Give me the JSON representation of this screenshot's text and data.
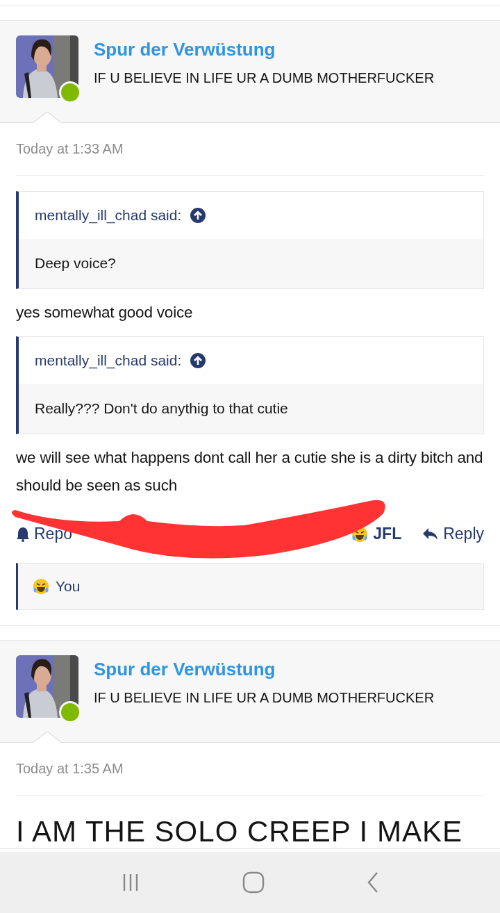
{
  "posts": [
    {
      "author": "Spur der Verwüstung",
      "user_title": "IF U BELIEVE IN LIFE UR A DUMB MOTHERFUCKER",
      "online": true,
      "time": "Today at 1:33 AM",
      "blocks": [
        {
          "kind": "quote",
          "attribution": "mentally_ill_chad said:",
          "text": "Deep voice?"
        },
        {
          "kind": "text",
          "text": "yes somewhat good voice"
        },
        {
          "kind": "quote",
          "attribution": "mentally_ill_chad said:",
          "text": "Really??? Don't do anythig to that cutie"
        },
        {
          "kind": "text",
          "text": "we will see what happens dont call her a cutie she is a dirty bitch and should be seen as such"
        }
      ],
      "actions": [
        {
          "kind": "report",
          "label": "Repo"
        },
        {
          "kind": "react",
          "label": "JFL"
        },
        {
          "kind": "reply",
          "label": "Reply"
        }
      ],
      "reactions": [
        "You"
      ]
    },
    {
      "author": "Spur der Verwüstung",
      "user_title": "IF U BELIEVE IN LIFE UR A DUMB MOTHERFUCKER",
      "online": true,
      "time": "Today at 1:35 AM",
      "blocks": [
        {
          "kind": "big_text",
          "text": "I AM THE SOLO CREEP I MAKE"
        }
      ]
    }
  ]
}
